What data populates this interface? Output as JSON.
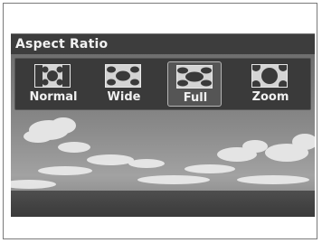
{
  "header": {
    "title": "Aspect Ratio"
  },
  "options": [
    {
      "label": "Normal",
      "icon": "aspect-normal-icon",
      "selected": false
    },
    {
      "label": "Wide",
      "icon": "aspect-wide-icon",
      "selected": false
    },
    {
      "label": "Full",
      "icon": "aspect-full-icon",
      "selected": true
    },
    {
      "label": "Zoom",
      "icon": "aspect-zoom-icon",
      "selected": false
    }
  ],
  "colors": {
    "header": "#3d3d3d",
    "selected_border": "#b5b5b5",
    "text": "#f0f0f0"
  }
}
